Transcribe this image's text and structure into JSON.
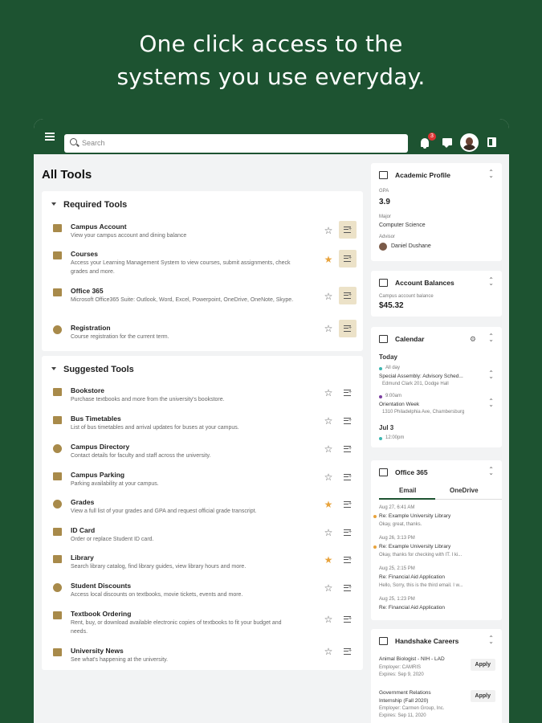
{
  "headline": {
    "line1": "One click access to the",
    "line2": "systems you use everyday."
  },
  "topbar": {
    "search_placeholder": "Search",
    "notifications_count": "3"
  },
  "page_title": "All Tools",
  "required": {
    "heading": "Required Tools",
    "tools": [
      {
        "name": "Campus Account",
        "desc": "View your campus account and dining balance",
        "starred": false,
        "added": true
      },
      {
        "name": "Courses",
        "desc": "Access your Learning Management System to view courses, submit assignments, check grades and more.",
        "starred": true,
        "added": true
      },
      {
        "name": "Office 365",
        "desc": "Microsoft Office365 Suite: Outlook, Word, Excel, Powerpoint, OneDrive, OneNote, Skype.",
        "starred": false,
        "added": true
      },
      {
        "name": "Registration",
        "desc": "Course registration for the current term.",
        "starred": false,
        "added": true
      }
    ]
  },
  "suggested": {
    "heading": "Suggested Tools",
    "tools": [
      {
        "name": "Bookstore",
        "desc": "Purchase textbooks and more from the university's bookstore.",
        "starred": false
      },
      {
        "name": "Bus Timetables",
        "desc": "List of bus timetables and arrival updates for buses at your campus.",
        "starred": false
      },
      {
        "name": "Campus Directory",
        "desc": "Contact details for faculty and staff across the university.",
        "starred": false
      },
      {
        "name": "Campus Parking",
        "desc": "Parking availability at your campus.",
        "starred": false
      },
      {
        "name": "Grades",
        "desc": "View a full list of your grades and GPA and request official grade transcript.",
        "starred": true
      },
      {
        "name": "ID Card",
        "desc": "Order or replace Student ID card.",
        "starred": false
      },
      {
        "name": "Library",
        "desc": "Search library catalog, find library guides, view library hours and more.",
        "starred": true
      },
      {
        "name": "Student Discounts",
        "desc": "Access local discounts on textbooks, movie tickets, events and more.",
        "starred": false
      },
      {
        "name": "Textbook Ordering",
        "desc": "Rent, buy, or download available electronic copies of textbooks to fit your budget and needs.",
        "starred": false
      },
      {
        "name": "University News",
        "desc": "See what's happening at the university.",
        "starred": false
      }
    ]
  },
  "academic": {
    "title": "Academic Profile",
    "gpa_label": "GPA",
    "gpa": "3.9",
    "major_label": "Major",
    "major": "Computer Science",
    "advisor_label": "Advisor",
    "advisor": "Daniel Dushane"
  },
  "balances": {
    "title": "Account Balances",
    "label": "Campus account balance",
    "value": "$45.32"
  },
  "calendar": {
    "title": "Calendar",
    "today": "Today",
    "events": [
      {
        "time": "All day",
        "title": "Special Assembly: Advisory Sched...",
        "loc": "Edmund Clark 201, Dodge Hall",
        "color": "#3cb6b0"
      },
      {
        "time": "9:00am",
        "title": "Orientation Week",
        "loc": "1310 Philadelphia Ave, Chambersburg",
        "color": "#7b3fa0"
      }
    ],
    "date2": "Jul 3",
    "time3": "12:00pm"
  },
  "office": {
    "title": "Office 365",
    "tabs": [
      "Email",
      "OneDrive"
    ],
    "emails": [
      {
        "date": "Aug 27, 6:41 AM",
        "subject": "Re: Example University Library",
        "preview": "Okay, great, thanks.",
        "unread": true
      },
      {
        "date": "Aug 26, 3:13 PM",
        "subject": "Re: Example University Library",
        "preview": "Okay, thanks for checking with IT. I ki...",
        "unread": true
      },
      {
        "date": "Aug 25, 2:15 PM",
        "subject": "Re: Financial Aid Application",
        "preview": "Hello, Sorry, this is the third email. I w...",
        "unread": false
      },
      {
        "date": "Aug 25, 1:23 PM",
        "subject": "Re: Financial Aid Application",
        "preview": "",
        "unread": false
      }
    ]
  },
  "handshake": {
    "title": "Handshake Careers",
    "jobs": [
      {
        "title": "Animal Biologist - NIH - LAD",
        "employer": "Employer: CAMRIS",
        "expires": "Expires: Sep 9, 2020",
        "apply": "Apply"
      },
      {
        "title": "Government Relations Internship (Fall 2020)",
        "employer": "Employer: Carmen Group, Inc.",
        "expires": "Expires: Sep 11, 2020",
        "apply": "Apply"
      }
    ]
  },
  "colors": {
    "brand": "#1d5331",
    "accent": "#e8a33c",
    "icon": "#a88a4a"
  }
}
